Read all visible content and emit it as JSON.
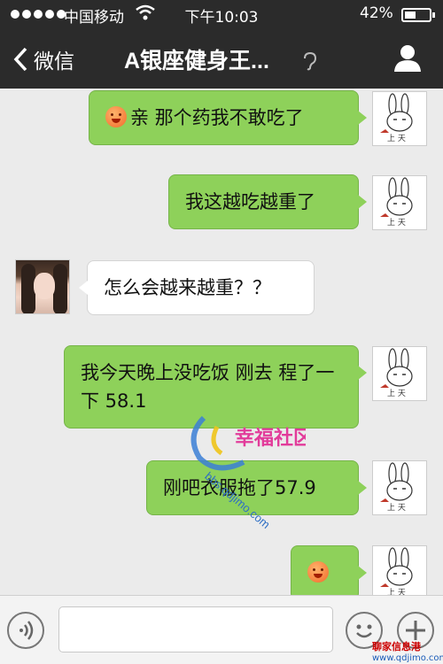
{
  "status_bar": {
    "carrier": "中国移动",
    "time": "下午10:03",
    "battery": "42%"
  },
  "nav": {
    "back_label": "微信",
    "title": "A银座健身王..."
  },
  "messages": [
    {
      "side": "me",
      "emoji": true,
      "text": "亲 那个药我不敢吃了"
    },
    {
      "side": "me",
      "emoji": false,
      "text": "我这越吃越重了"
    },
    {
      "side": "other",
      "emoji": false,
      "text": "怎么会越来越重？？"
    },
    {
      "side": "me",
      "emoji": false,
      "text": "我今天晚上没吃饭 刚去 程了一下 58.1"
    },
    {
      "side": "me",
      "emoji": false,
      "text": "刚吧衣服拖了57.9"
    },
    {
      "side": "me",
      "emoji": true,
      "text": ""
    }
  ],
  "avatar_caption": "上 天",
  "watermark": {
    "url": "bbs.qdjimo.com",
    "brand": "幸福社区"
  },
  "corner_logo": {
    "brand": "聊家信息港",
    "url": "www.qdjimo.com"
  },
  "colors": {
    "nav_bg": "#2b2b2b",
    "bubble_me": "#8ed15a",
    "bubble_other": "#ffffff",
    "chat_bg": "#ebebeb"
  }
}
